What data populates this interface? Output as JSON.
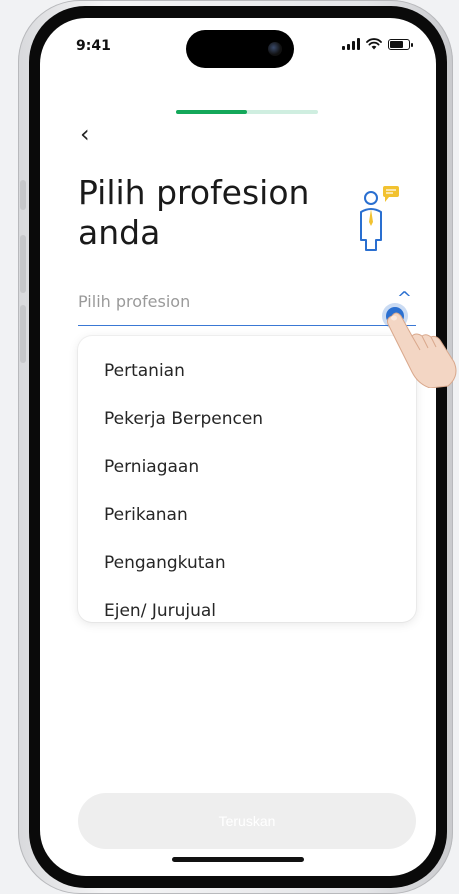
{
  "status_bar": {
    "time": "9:41"
  },
  "header": {
    "back_label": "‹",
    "progress": 0.5
  },
  "title": "Pilih profesion anda",
  "select": {
    "placeholder": "Pilih profesion",
    "chevron": "^"
  },
  "dropdown": {
    "items": [
      {
        "label": "Pertanian"
      },
      {
        "label": "Pekerja Berpencen"
      },
      {
        "label": "Perniagaan"
      },
      {
        "label": "Perikanan"
      },
      {
        "label": "Pengangkutan"
      },
      {
        "label": "Ejen/ Jurujual"
      }
    ]
  },
  "footer": {
    "continue_label": "Teruskan"
  },
  "colors": {
    "accent_green": "#14a85a",
    "accent_blue": "#2a6fd0",
    "illustration_yellow": "#f2c230"
  },
  "icons": [
    "back-icon",
    "chevron-up-icon",
    "profession-icon",
    "signal-icon",
    "wifi-icon",
    "battery-icon",
    "pointing-hand-icon"
  ]
}
